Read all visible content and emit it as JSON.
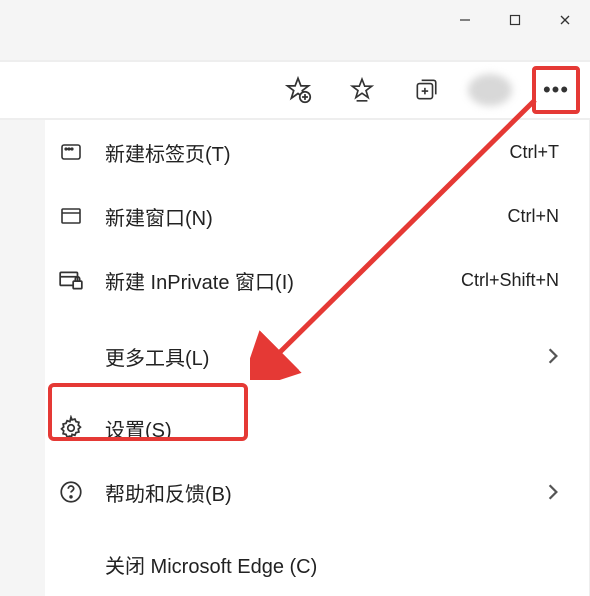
{
  "window_controls": {
    "minimize": "─",
    "maximize": "□",
    "close": "✕"
  },
  "toolbar": {
    "add_favorite": "add-to-favorites",
    "favorites": "favorites",
    "collections": "collections",
    "profile": "profile",
    "more": "•••"
  },
  "menu": {
    "new_tab": {
      "label": "新建标签页(T)",
      "shortcut": "Ctrl+T"
    },
    "new_window": {
      "label": "新建窗口(N)",
      "shortcut": "Ctrl+N"
    },
    "new_inprivate": {
      "label": "新建 InPrivate 窗口(I)",
      "shortcut": "Ctrl+Shift+N"
    },
    "more_tools": {
      "label": "更多工具(L)",
      "chevron": "›"
    },
    "settings": {
      "label": "设置(S)"
    },
    "help": {
      "label": "帮助和反馈(B)",
      "chevron": "›"
    },
    "close_edge": {
      "label": "关闭 Microsoft Edge (C)"
    }
  }
}
